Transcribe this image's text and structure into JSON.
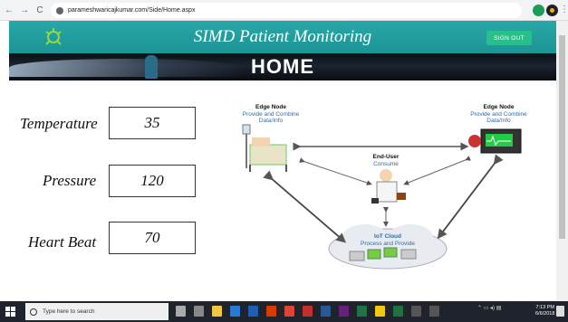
{
  "browser": {
    "url": "parameshwaricajkumar.com/Side/Home.aspx",
    "nav": {
      "back": "←",
      "forward": "→",
      "reload": "C"
    }
  },
  "header": {
    "title": "SIMD Patient Monitoring",
    "signout_label": "SIGN OUT"
  },
  "banner": {
    "title": "HOME"
  },
  "vitals": [
    {
      "label": "Temperature",
      "value": "35"
    },
    {
      "label": "Pressure",
      "value": "120"
    },
    {
      "label": "Heart Beat",
      "value": "70"
    }
  ],
  "diagram": {
    "edge_left": {
      "title": "Edge Node",
      "line1": "Provide and Combine",
      "line2": "Data/Info"
    },
    "edge_right": {
      "title": "Edge Node",
      "line1": "Provide and Combine",
      "line2": "Data/Info"
    },
    "end_user": {
      "title": "End-User",
      "line1": "Consume"
    },
    "cloud": {
      "title": "IoT Cloud",
      "line1": "Process and Provide"
    }
  },
  "taskbar": {
    "search_placeholder": "Type here to search",
    "time": "7:13 PM",
    "date": "6/6/2018"
  },
  "colors": {
    "header_bg": "#1b9494",
    "signout_bg": "#27c08a",
    "diagram_text": "#2f6aa8"
  }
}
